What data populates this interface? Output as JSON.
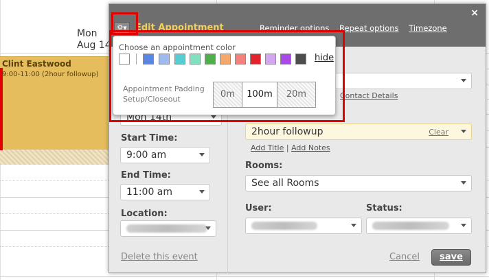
{
  "calendar": {
    "day_name": "Mon",
    "day_date": "Aug 14",
    "appointment_title": "Clint Eastwood",
    "appointment_subtitle": "9:00-11:00 (2hour followup)"
  },
  "dialog": {
    "title": "Edit Appointment",
    "header_links": [
      "Reminder options",
      "Repeat options",
      "Timezone"
    ],
    "close_symbol": "×",
    "date_value": "Mon 14th",
    "start_time_label": "Start Time:",
    "start_time_value": "9:00 am",
    "end_time_label": "End Time:",
    "end_time_value": "11:00 am",
    "location_label": "Location:",
    "contact_details_link": "Contact Details",
    "service_value": "2hour followup",
    "service_clear": "Clear",
    "add_title_link": "Add Title",
    "add_notes_link": "Add Notes",
    "rooms_label": "Rooms:",
    "rooms_value": "See all Rooms",
    "user_label": "User:",
    "status_label": "Status:",
    "delete_link": "Delete this event",
    "cancel_link": "Cancel",
    "save_button": "save"
  },
  "color_popup": {
    "title": "Choose an appointment color",
    "hide_link": "hide",
    "colors": [
      "#ffffff",
      "#5b87e4",
      "#9fb9f1",
      "#56cdd3",
      "#81e0bd",
      "#4fb04a",
      "#f5a869",
      "#f4817c",
      "#e1242b",
      "#d4a6f1",
      "#a94ae6",
      "#4d4d4d"
    ],
    "padding_label_line1": "Appointment Padding",
    "padding_label_line2": "Setup/Closeout",
    "padding_options": [
      "0m",
      "100m",
      "20m"
    ],
    "padding_selected": "100m"
  },
  "icons": {
    "gear": "gear-icon",
    "chevron": "chevron-down-icon"
  },
  "colors": {
    "header_bg": "#6e6e6e",
    "title_color": "#f0d05a",
    "appointment_color": "#e6bd5c",
    "highlight_red": "#e10000"
  }
}
